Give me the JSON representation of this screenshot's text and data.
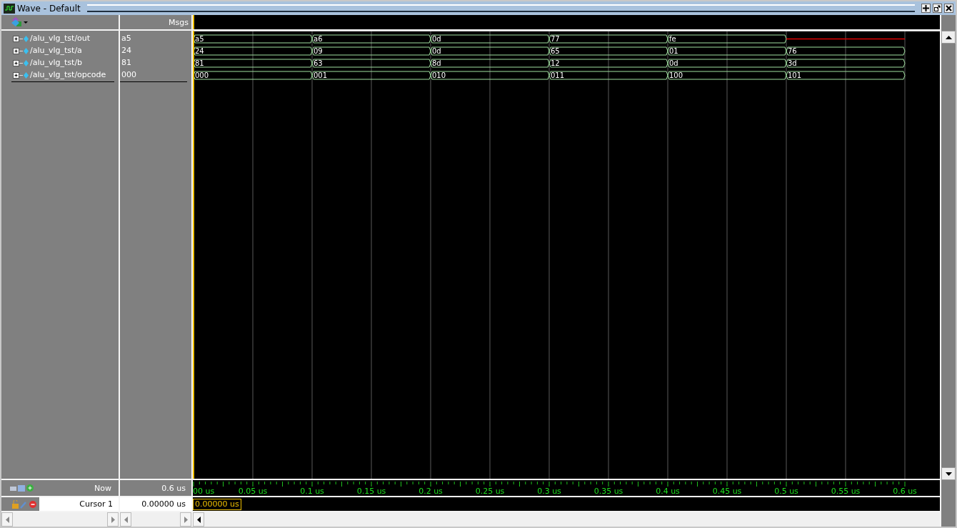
{
  "window": {
    "title": "Wave - Default"
  },
  "header": {
    "value_column": "Msgs"
  },
  "signals": [
    {
      "name": "/alu_vlg_tst/out",
      "value": "a5",
      "segments": [
        {
          "kind": "bus",
          "value": "a5"
        },
        {
          "kind": "bus",
          "value": "a6"
        },
        {
          "kind": "bus",
          "value": "0d"
        },
        {
          "kind": "bus",
          "value": "77"
        },
        {
          "kind": "bus",
          "value": "fe"
        },
        {
          "kind": "x"
        }
      ]
    },
    {
      "name": "/alu_vlg_tst/a",
      "value": "24",
      "segments": [
        {
          "kind": "bus",
          "value": "24"
        },
        {
          "kind": "bus",
          "value": "09"
        },
        {
          "kind": "bus",
          "value": "0d"
        },
        {
          "kind": "bus",
          "value": "65"
        },
        {
          "kind": "bus",
          "value": "01"
        },
        {
          "kind": "bus",
          "value": "76"
        }
      ]
    },
    {
      "name": "/alu_vlg_tst/b",
      "value": "81",
      "segments": [
        {
          "kind": "bus",
          "value": "81"
        },
        {
          "kind": "bus",
          "value": "63"
        },
        {
          "kind": "bus",
          "value": "8d"
        },
        {
          "kind": "bus",
          "value": "12"
        },
        {
          "kind": "bus",
          "value": "0d"
        },
        {
          "kind": "bus",
          "value": "3d"
        }
      ]
    },
    {
      "name": "/alu_vlg_tst/opcode",
      "value": "000",
      "segments": [
        {
          "kind": "bus",
          "value": "000"
        },
        {
          "kind": "bus",
          "value": "001"
        },
        {
          "kind": "bus",
          "value": "010"
        },
        {
          "kind": "bus",
          "value": "011"
        },
        {
          "kind": "bus",
          "value": "100"
        },
        {
          "kind": "bus",
          "value": "101"
        }
      ]
    }
  ],
  "now": {
    "label": "Now",
    "value": "0.6 us"
  },
  "cursor": {
    "label": "Cursor 1",
    "value": "0.00000 us",
    "marker": "0.00000 us"
  },
  "time_axis": [
    "00 us",
    "0.05 us",
    "0.1 us",
    "0.15 us",
    "0.2 us",
    "0.25 us",
    "0.3 us",
    "0.35 us",
    "0.4 us",
    "0.45 us",
    "0.5 us",
    "0.55 us",
    "0.6 us"
  ]
}
